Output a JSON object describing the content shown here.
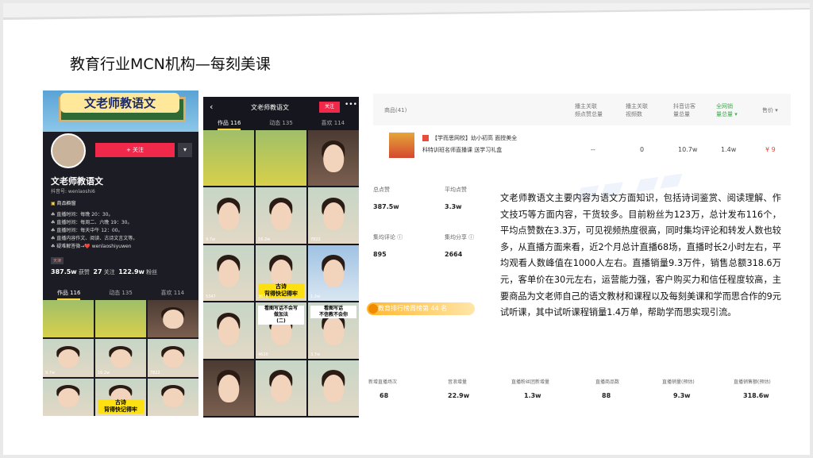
{
  "slide": {
    "title": "教育行业MCN机构—每刻美课"
  },
  "left_phone": {
    "banner_text": "文老师教语文",
    "follow": "+ 关注",
    "more": "▾",
    "name": "文老师教语文",
    "id": "抖音号: wenlaoshi6",
    "window_label": "商品橱窗",
    "info": [
      "直播时间：每晚 20：30。",
      "直播时间：每周二、六晚 19：30。",
      "直播时间：每天中午 12：00。",
      "直播内容作文、阅读、古诗文言文等。",
      "疑难解答微→❤️ wenlaoshiyuwen"
    ],
    "tag": "天津",
    "stats": {
      "likes": "387.5w",
      "likes_label": "获赞",
      "follows": "27",
      "follows_label": "关注",
      "fans": "122.9w",
      "fans_label": "粉丝"
    },
    "tabs": [
      "作品 116",
      "动态 135",
      "喜欢 114"
    ],
    "thumbs": [
      {
        "count": "",
        "cap": "",
        "style": "field"
      },
      {
        "count": "",
        "cap": "",
        "style": "field"
      },
      {
        "count": "",
        "cap": "",
        "style": "dark"
      },
      {
        "count": "9.7w",
        "cap": "",
        "style": "plain"
      },
      {
        "count": "16.2w",
        "cap": "",
        "style": "plain"
      },
      {
        "count": "7822",
        "cap": "",
        "style": "plain"
      },
      {
        "count": "",
        "cap": "",
        "style": "plain"
      },
      {
        "count": "",
        "cap": "古诗\n背得快记得牢",
        "style": "yellow"
      },
      {
        "count": "",
        "cap": "",
        "style": "plain"
      }
    ]
  },
  "mid_phone": {
    "back": "‹",
    "title": "文老师教语文",
    "follow": "关注",
    "more": "•••",
    "tabs": [
      "作品 116",
      "动态 135",
      "喜欢 114"
    ],
    "thumbs": [
      {
        "count": "",
        "cap": "",
        "style": "field"
      },
      {
        "count": "",
        "cap": "",
        "style": "field"
      },
      {
        "count": "",
        "cap": "",
        "style": "dark"
      },
      {
        "count": "9.7w",
        "cap": "",
        "style": "plain"
      },
      {
        "count": "16.2w",
        "cap": "",
        "style": "plain"
      },
      {
        "count": "7822",
        "cap": "",
        "style": "plain"
      },
      {
        "count": "5347",
        "cap": "",
        "style": "plain"
      },
      {
        "count": "3670",
        "cap": "古诗\n背得快记得牢",
        "style": "yellow"
      },
      {
        "count": "1.2w",
        "cap": "",
        "style": "blue"
      },
      {
        "count": "",
        "cap": "",
        "style": "plain"
      },
      {
        "count": "4620",
        "cap": "看图写话不会写\n做加法\n(二)",
        "style": "topwhite"
      },
      {
        "count": "3.7w",
        "cap": "看图写话\n不信教不会你",
        "style": "topwhite"
      },
      {
        "count": "",
        "cap": "",
        "style": "dark"
      },
      {
        "count": "",
        "cap": "",
        "style": "plain"
      },
      {
        "count": "",
        "cap": "",
        "style": "plain"
      },
      {
        "count": "5610",
        "cap": "",
        "style": "plain"
      },
      {
        "count": "5830",
        "cap": "",
        "style": "plain"
      },
      {
        "count": "2958",
        "cap": "",
        "style": "plain"
      }
    ]
  },
  "table": {
    "headers": [
      "商品(41)",
      "播主关联\n频点赞总量",
      "播主关联\n视频数",
      "抖音访客\n量总量",
      "全网销\n量总量 ▾",
      "售价 ▾"
    ],
    "product": {
      "name": "【学而思网校】幼小初高 面授美全",
      "name2": "科特训班名师直播课 送学习礼盒",
      "likes": "--",
      "videos": "0",
      "visitors": "10.7w",
      "sales": "1.4w",
      "price": "¥ 9"
    }
  },
  "metrics": [
    {
      "label": "总点赞",
      "value": "387.5w"
    },
    {
      "label": "平均点赞",
      "value": "3.3w"
    },
    {
      "label": "集均评论 ⓘ",
      "value": "895"
    },
    {
      "label": "集均分享 ⓘ",
      "value": "2664"
    }
  ],
  "rank_badge": "教育排行榜周榜第 44 名",
  "description": "文老师教语文主要内容为语文方面知识，包括诗词鉴赏、阅读理解、作文技巧等方面内容，干货较多。目前粉丝为123万，总计发布116个，平均点赞数在3.3万，可见视频热度很高，同时集均评论和转发人数也较多，从直播方面来看，近2个月总计直播68场，直播时长2小时左右，平均观看人数峰值在1000人左右。直播销量9.3万件，销售总额318.6万元，客单价在30元左右，运营能力强，客户购买力和信任程度较高，主要商品为文老师自己的语文教材和课程以及每刻美课和学而思合作的9元试听课，其中试听课程销量1.4万单，帮助学而思实现引流。",
  "bottom_stats": [
    {
      "label": "新增直播场次",
      "value": "68"
    },
    {
      "label": "音浪增量",
      "value": "22.9w"
    },
    {
      "label": "直播粉丝团新增量",
      "value": "1.3w"
    },
    {
      "label": "直播商品数",
      "value": "88"
    },
    {
      "label": "直播销量(预估)",
      "value": "9.3w"
    },
    {
      "label": "直播销售额(预估)",
      "value": "318.6w"
    }
  ],
  "colors": {
    "accent_red": "#f0284a",
    "yellow_caption": "#fce012",
    "green_header": "#3cb04a"
  }
}
